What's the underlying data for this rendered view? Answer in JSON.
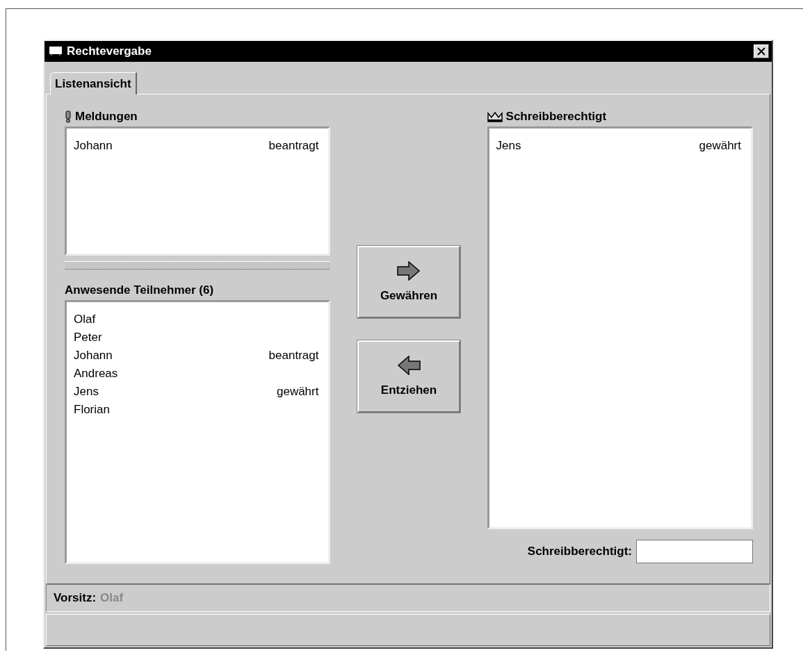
{
  "window": {
    "title": "Rechtevergabe"
  },
  "tabs": [
    {
      "label": "Listenansicht",
      "selected": true
    }
  ],
  "messages": {
    "title": "Meldungen",
    "items": [
      {
        "name": "Johann",
        "status": "beantragt"
      }
    ]
  },
  "participants": {
    "title": "Anwesende Teilnehmer (6)",
    "items": [
      {
        "name": "Olaf"
      },
      {
        "name": "Peter"
      },
      {
        "name": "Johann",
        "status": "beantragt"
      },
      {
        "name": "Andreas"
      },
      {
        "name": "Jens",
        "status": "gewährt"
      },
      {
        "name": "Florian"
      }
    ]
  },
  "buttons": [
    {
      "label": "Gewähren",
      "kind": "right"
    },
    {
      "label": "Entziehen",
      "kind": "left"
    }
  ],
  "writers": {
    "title": "Schreibberechtigt",
    "items": [
      {
        "name": "Jens",
        "status": "gewährt"
      }
    ],
    "field_label": "Schreibberechtigt:"
  },
  "status": {
    "label": "Vorsitz:",
    "value": "Olaf"
  }
}
